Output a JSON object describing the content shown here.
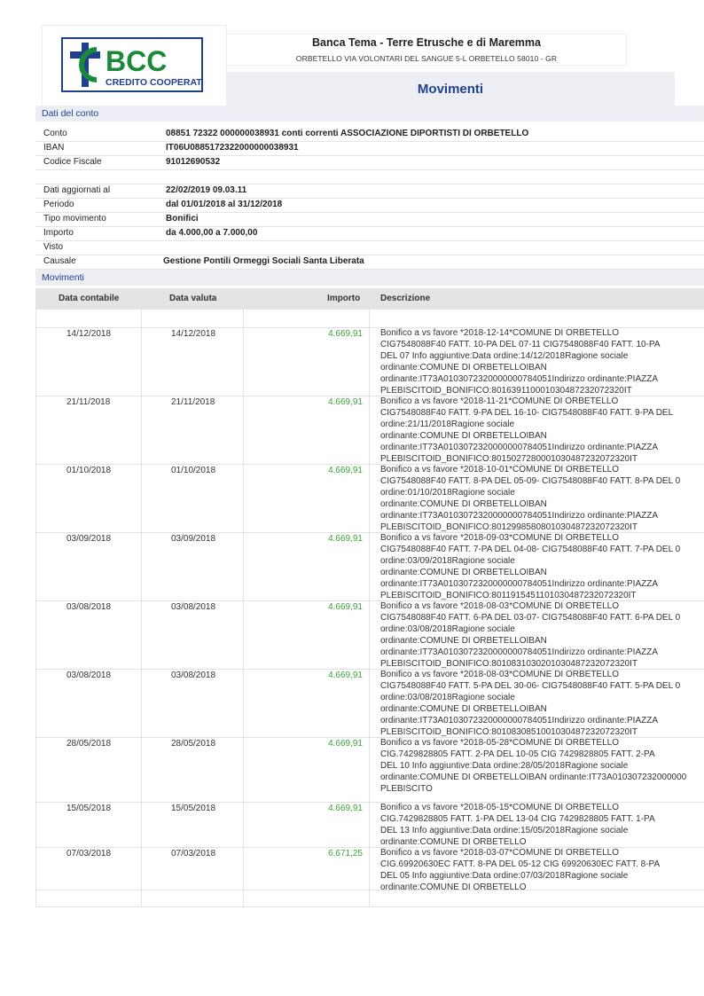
{
  "header": {
    "logo_text": "BCC",
    "logo_subtitle": "CREDITO COOPERATIVO",
    "bank_name": "Banca Tema - Terre Etrusche e di Maremma",
    "bank_address": "ORBETELLO VIA VOLONTARI DEL SANGUE 5-L ORBETELLO 58010 - GR",
    "page_title": "Movimenti"
  },
  "account_section": {
    "title": "Dati del conto",
    "rows": [
      {
        "label": "Conto",
        "value": "08851 72322 000000038931 conti correnti ASSOCIAZIONE DIPORTISTI DI ORBETELLO"
      },
      {
        "label": "IBAN",
        "value": "IT06U0885172322000000038931"
      },
      {
        "label": "Codice Fiscale",
        "value": "91012690532"
      },
      {
        "label": "",
        "value": ""
      },
      {
        "label": "Dati aggiornati al",
        "value": "22/02/2019 09.03.11"
      },
      {
        "label": "Periodo",
        "value": " dal 01/01/2018 al 31/12/2018"
      },
      {
        "label": "Tipo movimento",
        "value": " Bonifici"
      },
      {
        "label": "Importo",
        "value": "da 4.000,00 a 7.000,00"
      },
      {
        "label": "Visto",
        "value": ""
      },
      {
        "label": "Causale",
        "value": "Gestione Pontili Ormeggi Sociali Santa Liberata"
      }
    ]
  },
  "movements_section": {
    "title": "Movimenti",
    "columns": {
      "date_accounting": "Data contabile",
      "date_value": "Data valuta",
      "amount": "Importo",
      "description": "Descrizione"
    },
    "rows": [
      {
        "date_accounting": "14/12/2018",
        "date_value": "14/12/2018",
        "amount": "4.669,91",
        "description": [
          "Bonifico a vs favore *2018-12-14*COMUNE DI ORBETELLO",
          "CIG7548088F40 FATT. 10-PA DEL 07-11 CIG7548088F40 FATT. 10-PA",
          "DEL 07 Info aggiuntive:Data ordine:14/12/2018Ragione sociale",
          "ordinante:COMUNE DI ORBETELLOIBAN",
          "ordinante:IT73A0103072320000000784051Indirizzo ordinante:PIAZZA",
          "PLEBISCITOID_BONIFICO:80163911000103048723207232​0IT"
        ]
      },
      {
        "date_accounting": "21/11/2018",
        "date_value": "21/11/2018",
        "amount": "4.669,91",
        "description": [
          "Bonifico a vs favore *2018-11-21*COMUNE DI ORBETELLO",
          "CIG7548088F40 FATT. 9-PA DEL 16-10- CIG7548088F40 FATT. 9-PA DEL",
          "ordine:21/11/2018Ragione sociale",
          "ordinante:COMUNE DI ORBETELLOIBAN",
          "ordinante:IT73A0103072320000000784051Indirizzo ordinante:PIAZZA",
          "PLEBISCITOID_BONIFICO:801502728000103048723207232​0IT"
        ]
      },
      {
        "date_accounting": "01/10/2018",
        "date_value": "01/10/2018",
        "amount": "4.669,91",
        "description": [
          "Bonifico a vs favore *2018-10-01*COMUNE DI ORBETELLO",
          "CIG7548088F40 FATT. 8-PA DEL 05-09- CIG7548088F40 FATT. 8-PA DEL 0",
          "ordine:01/10/2018Ragione sociale",
          "ordinante:COMUNE DI ORBETELLOIBAN",
          "ordinante:IT73A0103072320000000784051Indirizzo ordinante:PIAZZA",
          "PLEBISCITOID_BONIFICO:801299858080103048723207232​0IT"
        ]
      },
      {
        "date_accounting": "03/09/2018",
        "date_value": "03/09/2018",
        "amount": "4.669,91",
        "description": [
          "Bonifico a vs favore *2018-09-03*COMUNE DI ORBETELLO",
          "CIG7548088F40 FATT. 7-PA DEL 04-08- CIG7548088F40 FATT. 7-PA DEL 0",
          "ordine:03/09/2018Ragione sociale",
          "ordinante:COMUNE DI ORBETELLOIBAN",
          "ordinante:IT73A0103072320000000784051Indirizzo ordinante:PIAZZA",
          "PLEBISCITOID_BONIFICO:801191545110103048723207232​0IT"
        ]
      },
      {
        "date_accounting": "03/08/2018",
        "date_value": "03/08/2018",
        "amount": "4.669,91",
        "description": [
          "Bonifico a vs favore *2018-08-03*COMUNE DI ORBETELLO",
          "CIG7548088F40 FATT. 6-PA DEL 03-07- CIG7548088F40 FATT. 6-PA DEL 0",
          "ordine:03/08/2018Ragione sociale",
          "ordinante:COMUNE DI ORBETELLOIBAN",
          "ordinante:IT73A0103072320000000784051Indirizzo ordinante:PIAZZA",
          "PLEBISCITOID_BONIFICO:801083103020103048723207232​0IT"
        ]
      },
      {
        "date_accounting": "03/08/2018",
        "date_value": "03/08/2018",
        "amount": "4.669,91",
        "description": [
          "Bonifico a vs favore *2018-08-03*COMUNE DI ORBETELLO",
          "CIG7548088F40 FATT. 5-PA DEL 30-06- CIG7548088F40 FATT. 5-PA DEL 0",
          "ordine:03/08/2018Ragione sociale",
          "ordinante:COMUNE DI ORBETELLOIBAN",
          "ordinante:IT73A0103072320000000784051Indirizzo ordinante:PIAZZA",
          "PLEBISCITOID_BONIFICO:801083085100103048723207232​0IT"
        ]
      },
      {
        "date_accounting": "28/05/2018",
        "date_value": "28/05/2018",
        "amount": "4.669,91",
        "description": [
          "Bonifico a vs favore *2018-05-28*COMUNE DI ORBETELLO",
          "CIG.7429828805 FATT. 2-PA DEL 10-05 CIG 7429828805 FATT. 2-PA",
          "DEL 10 Info aggiuntive:Data ordine:28/05/2018Ragione sociale",
          "ordinante:COMUNE DI ORBETELLOIBAN ordinante:IT73A010307232000000",
          "PLEBISCITO"
        ]
      },
      {
        "date_accounting": "15/05/2018",
        "date_value": "15/05/2018",
        "amount": "4.669,91",
        "description": [
          "Bonifico a vs favore *2018-05-15*COMUNE DI ORBETELLO",
          "CIG.7429828805 FATT. 1-PA DEL 13-04 CIG 7429828805 FATT. 1-PA",
          "DEL 13 Info aggiuntive:Data ordine:15/05/2018Ragione sociale",
          "ordinante:COMUNE DI ORBETELLO"
        ]
      },
      {
        "date_accounting": "07/03/2018",
        "date_value": "07/03/2018",
        "amount": "6.671,25",
        "description": [
          "Bonifico a vs favore *2018-03-07*COMUNE DI ORBETELLO",
          "CIG.69920630EC FATT. 8-PA DEL 05-12 CIG 69920630EC FATT. 8-PA",
          "DEL 05 Info aggiuntive:Data ordine:07/03/2018Ragione sociale",
          "ordinante:COMUNE DI ORBETELLO"
        ]
      }
    ]
  },
  "colors": {
    "accent_blue": "#1f3f8f",
    "logo_green": "#1a8a3a",
    "amount_green": "#3aa23a",
    "header_bg": "#eceef3"
  }
}
